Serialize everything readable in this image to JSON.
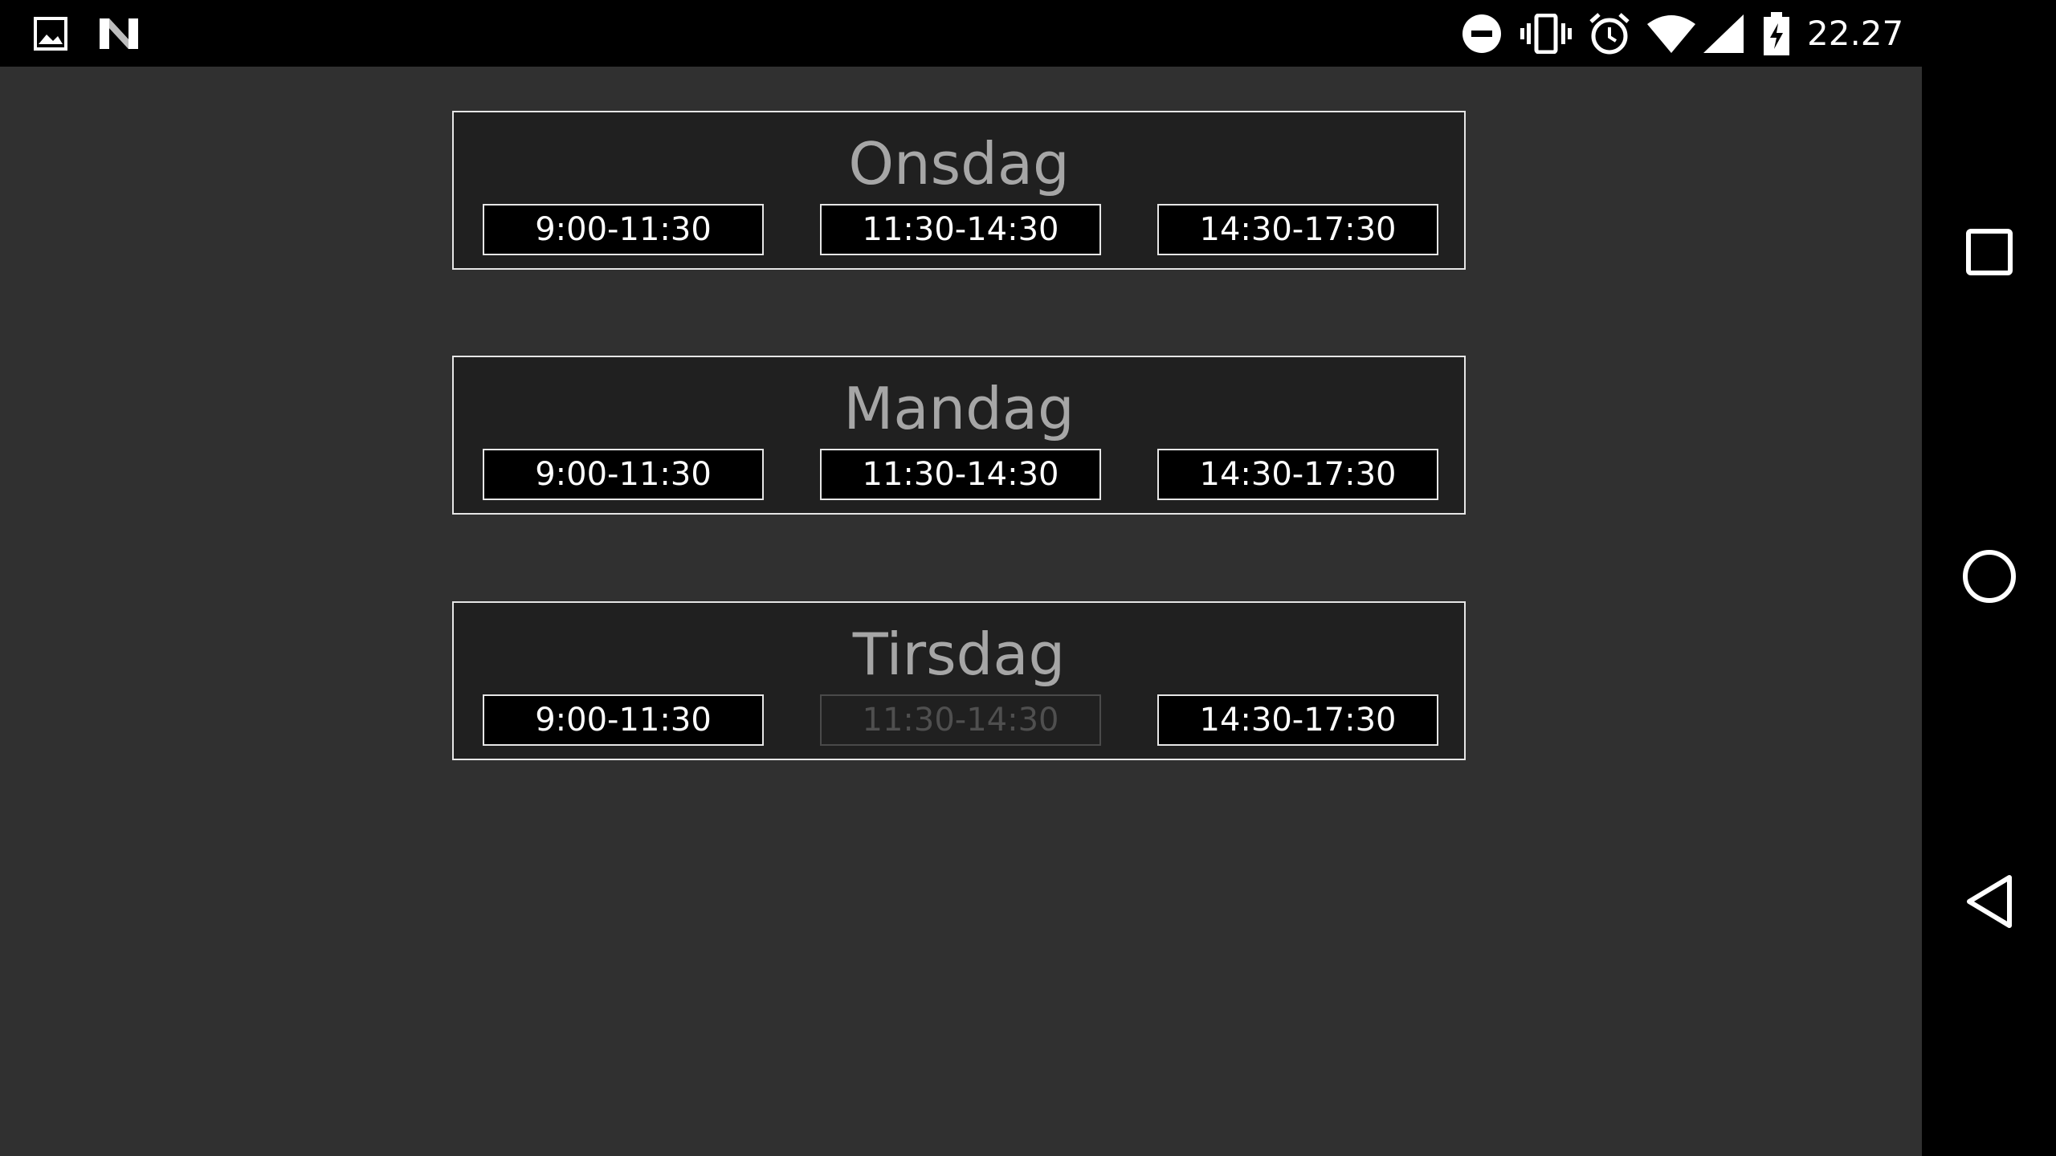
{
  "status_bar": {
    "left_icons": [
      "image-icon",
      "n-logo-icon"
    ],
    "right_icons": [
      "do-not-disturb-icon",
      "vibrate-icon",
      "alarm-icon",
      "wifi-icon",
      "cell-signal-icon",
      "battery-charging-icon"
    ],
    "time": "22.27"
  },
  "days": [
    {
      "name": "Onsdag",
      "slots": [
        {
          "label": "9:00-11:30",
          "enabled": true
        },
        {
          "label": "11:30-14:30",
          "enabled": true
        },
        {
          "label": "14:30-17:30",
          "enabled": true
        }
      ]
    },
    {
      "name": "Mandag",
      "slots": [
        {
          "label": "9:00-11:30",
          "enabled": true
        },
        {
          "label": "11:30-14:30",
          "enabled": true
        },
        {
          "label": "14:30-17:30",
          "enabled": true
        }
      ]
    },
    {
      "name": "Tirsdag",
      "slots": [
        {
          "label": "9:00-11:30",
          "enabled": true
        },
        {
          "label": "11:30-14:30",
          "enabled": false
        },
        {
          "label": "14:30-17:30",
          "enabled": true
        }
      ]
    }
  ],
  "nav_bar": {
    "buttons": [
      "recents-square-icon",
      "home-circle-icon",
      "back-triangle-icon"
    ]
  },
  "colors": {
    "background": "#303030",
    "card": "#202020",
    "border": "#e6e6e6",
    "title_text": "#a6a6a6",
    "disabled_text": "#4f4f4f"
  }
}
